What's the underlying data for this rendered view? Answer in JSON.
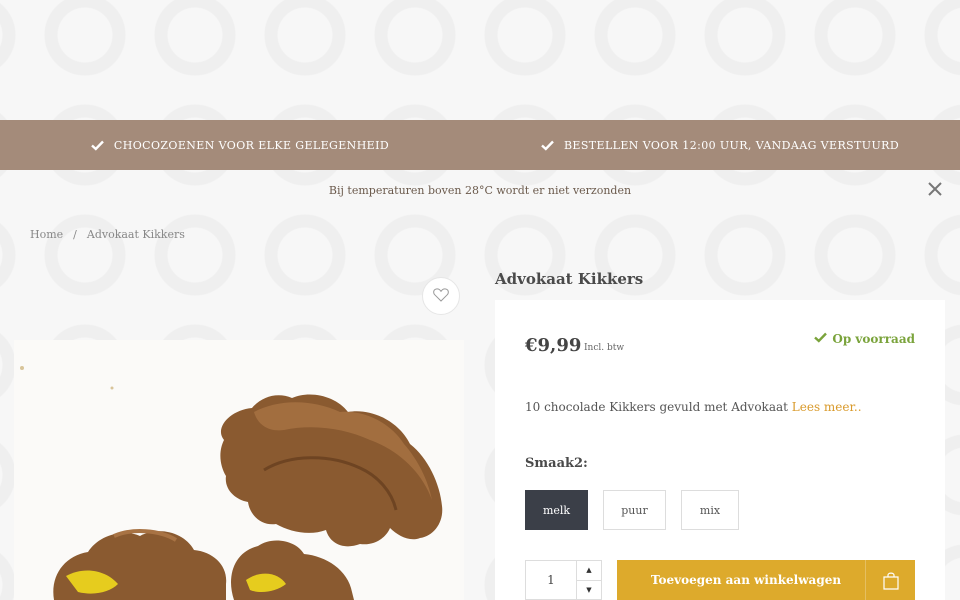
{
  "usp": [
    {
      "icon": "check-icon",
      "label": "CHOCOZOENEN VOOR ELKE GELEGENHEID"
    },
    {
      "icon": "check-icon",
      "label": "BESTELLEN VOOR 12:00 UUR, VANDAAG VERSTUURD"
    }
  ],
  "notice": {
    "text": "Bij temperaturen boven 28°C wordt er niet verzonden",
    "close_icon": "close-icon"
  },
  "breadcrumb": {
    "home": "Home",
    "separator": "/",
    "current": "Advokaat Kikkers"
  },
  "product": {
    "title": "Advokaat Kikkers",
    "price": "€9,99",
    "price_note": "Incl. btw",
    "stock": "Op voorraad",
    "description": "10 chocolade Kikkers gevuld met Advokaat",
    "read_more": "Lees meer..",
    "option_label": "Smaak2:",
    "options": [
      "melk",
      "puur",
      "mix"
    ],
    "selected_option": "melk",
    "quantity": "1",
    "add_to_cart": "Toevoegen aan winkelwagen",
    "wishlist_icon": "heart-icon",
    "cart_icon": "shopping-bag-icon"
  },
  "colors": {
    "usp_bar": "#a48b7a",
    "stock": "#7aa33b",
    "read_more": "#d99a2b",
    "add_to_cart": "#ddaa2c",
    "selected_option": "#3b3f48"
  }
}
